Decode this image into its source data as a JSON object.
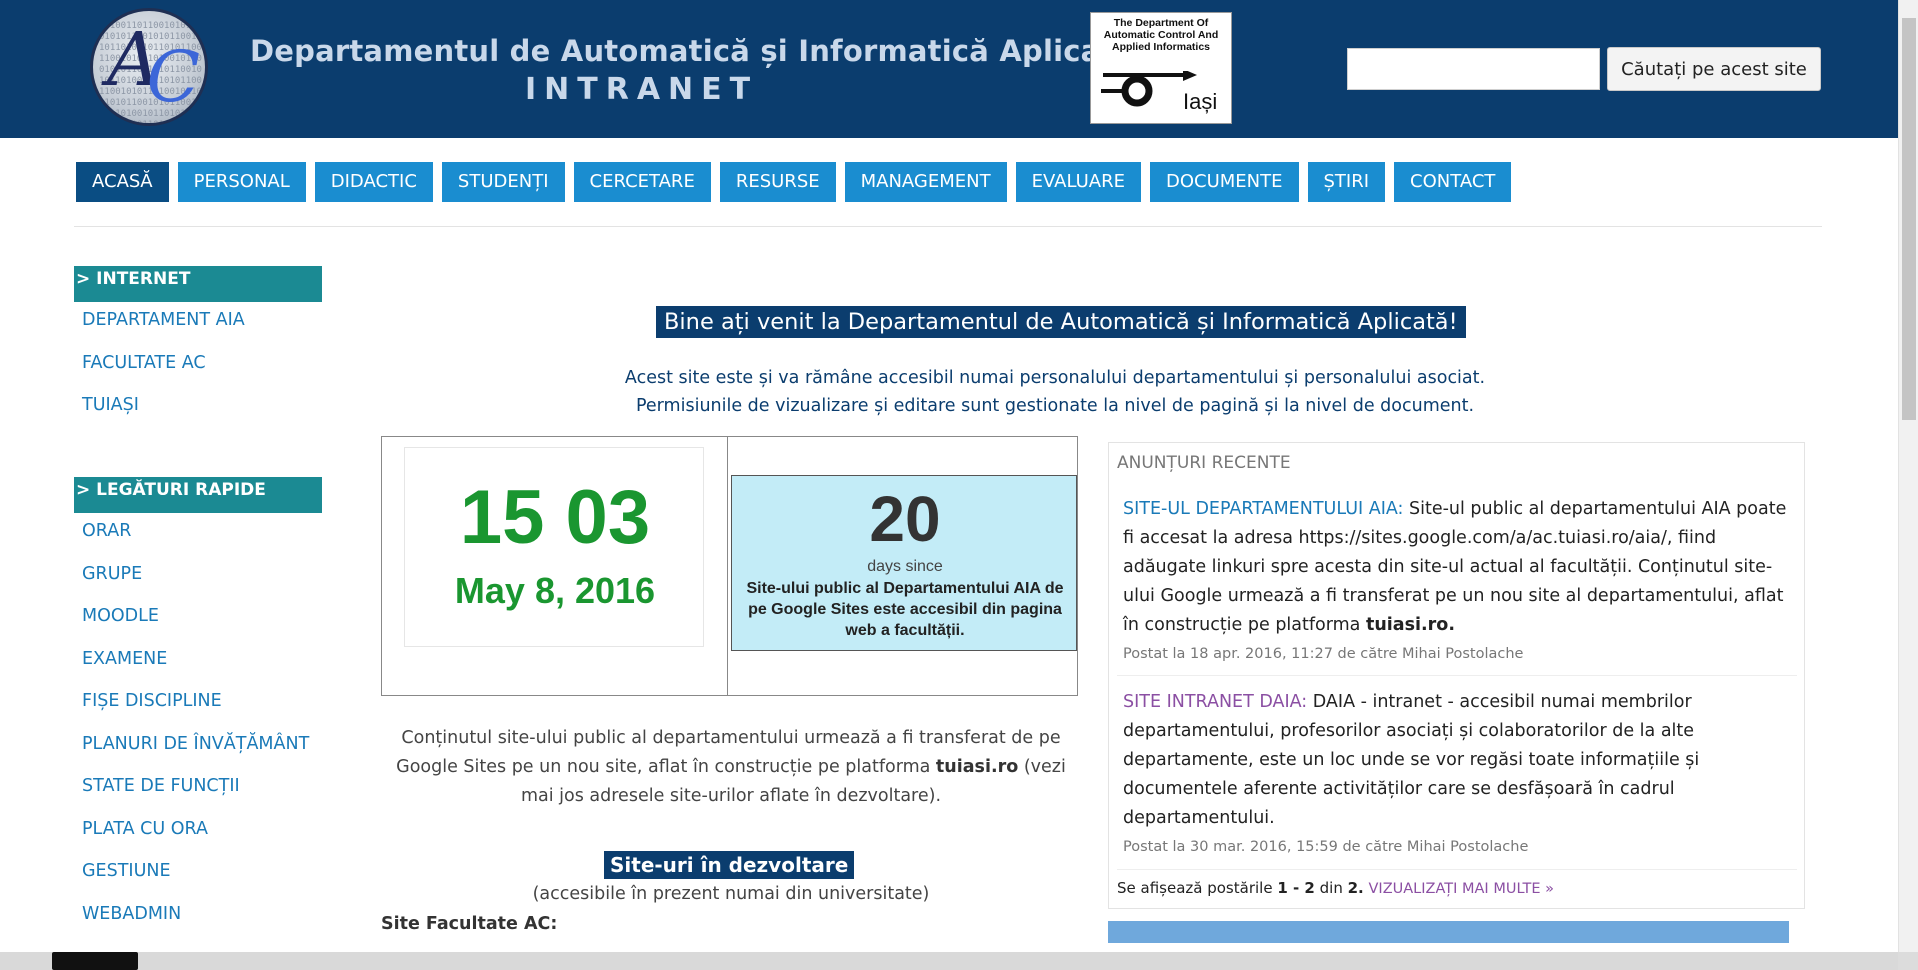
{
  "header": {
    "title": "Departamentul de Automatică și Informatică Aplicată",
    "subtitle": "INTRANET",
    "logo_text": "AC",
    "dept_logo": {
      "text": "The Department Of Automatic Control And Applied Informatics",
      "city": "Iași"
    },
    "search": {
      "placeholder": "",
      "button_label": "Căutați pe acest site"
    }
  },
  "nav": {
    "tabs": [
      {
        "label": "ACASĂ",
        "active": true
      },
      {
        "label": "PERSONAL",
        "active": false
      },
      {
        "label": "DIDACTIC",
        "active": false
      },
      {
        "label": "STUDENȚI",
        "active": false
      },
      {
        "label": "CERCETARE",
        "active": false
      },
      {
        "label": "RESURSE",
        "active": false
      },
      {
        "label": "MANAGEMENT",
        "active": false
      },
      {
        "label": "EVALUARE",
        "active": false
      },
      {
        "label": "DOCUMENTE",
        "active": false
      },
      {
        "label": "ȘTIRI",
        "active": false
      },
      {
        "label": "CONTACT",
        "active": false
      }
    ]
  },
  "sidebar": {
    "internet": {
      "heading": "> INTERNET",
      "items": [
        "DEPARTAMENT AIA",
        "FACULTATE AC",
        "TUIAȘI"
      ]
    },
    "quick_links": {
      "heading": "> LEGĂTURI RAPIDE",
      "items": [
        "ORAR",
        "GRUPE",
        "MOODLE",
        "EXAMENE",
        "FIȘE DISCIPLINE",
        "PLANURI DE ÎNVĂȚĂMÂNT",
        "STATE DE FUNCȚII",
        "PLATA CU ORA",
        "GESTIUNE",
        "WEBADMIN"
      ]
    }
  },
  "main": {
    "welcome": "Bine ați venit la Departamentul de Automatică și Informatică Aplicată!",
    "intro_line1": "Acest site este și va rămâne accesibil numai personalului departamentului și personalului asociat.",
    "intro_line2": "Permisiunile de vizualizare și editare sunt gestionate la nivel de pagină și la nivel de document.",
    "counter": {
      "time": "15 03",
      "date": "May 8, 2016",
      "days": "20",
      "days_label": "days since",
      "caption": "Site-ului public al Departamentului AIA de pe Google Sites este accesibil din pagina web a facultății."
    },
    "content_note_a": "Conținutul site-ului public al departamentului urmează a fi transferat de pe Google Sites pe un nou site, aflat în construcție pe platforma ",
    "content_note_bold": "tuiasi.ro",
    "content_note_b": " (vezi mai jos adresele site-urilor aflate în dezvoltare).",
    "dev_title": "Site-uri în dezvoltare",
    "dev_sub": "(accesibile în prezent numai din universitate)",
    "fac_label": "Site Facultate AC:"
  },
  "announcements": {
    "heading": "ANUNȚURI RECENTE",
    "posts": [
      {
        "title": "SITE-UL DEPARTAMENTULUI AIA:",
        "title_color": "#1a7ab8",
        "body_a": " Site-ul public al departamentului AIA poate fi accesat la adresa https://sites.google.com/a/ac.tuiasi.ro/aia/, fiind adăugate linkuri spre acesta din site-ul actual al facultății. Conținutul site-ului Google urmează a fi transferat pe un nou site al departamentului, aflat în construcție pe platforma ",
        "body_bold": "tuiasi.ro.",
        "meta": "Postat la 18 apr. 2016, 11:27 de către Mihai Postolache"
      },
      {
        "title": "SITE INTRANET DAIA:",
        "title_color": "#8b4fa3",
        "body_a": " DAIA - intranet - accesibil numai membrilor departamentului, profesorilor asociați și colaboratorilor de la alte departamente, este un loc unde se vor regăsi toate informațiile și documentele aferente activităților care se desfășoară în cadrul departamentului.",
        "body_bold": "",
        "meta": "Postat la 30 mar. 2016, 15:59 de către Mihai Postolache"
      }
    ],
    "footer_a": "Se afișează postările ",
    "footer_range": "1 - 2",
    "footer_b": " din ",
    "footer_total": "2.",
    "more_label": "VIZUALIZAȚI MAI MULTE »"
  },
  "colors": {
    "header_bg": "#0b3d6e",
    "nav_tab": "#1a8dd0",
    "nav_active": "#0a4d83",
    "sidebar_head": "#1b8a93",
    "counter_green": "#1a9630",
    "days_bg": "#c3ecf7"
  }
}
